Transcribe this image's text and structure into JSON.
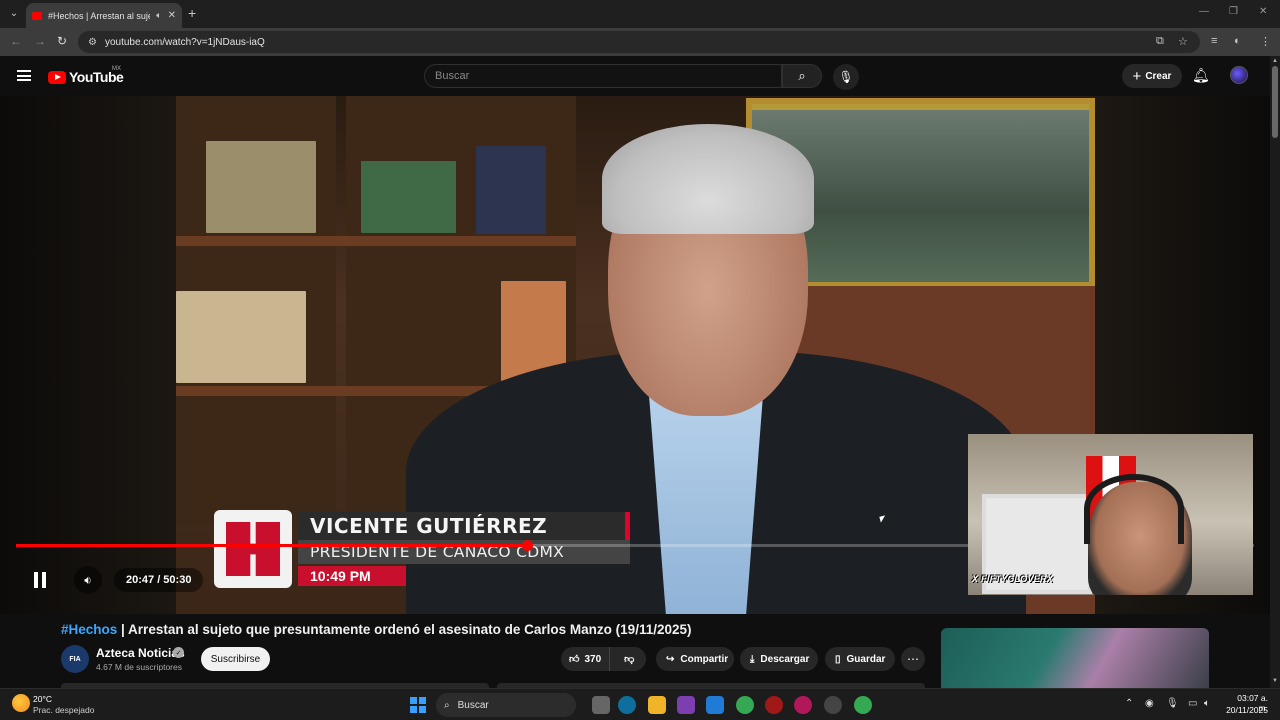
{
  "browser": {
    "tab_title": "#Hechos | Arrestan al sujeto",
    "url": "youtube.com/watch?v=1jNDaus-iaQ"
  },
  "youtube": {
    "logo_text": "YouTube",
    "country_code": "MX",
    "search_placeholder": "Buscar",
    "create_label": "Crear"
  },
  "player": {
    "lower_third_name": "VICENTE GUTIÉRREZ",
    "lower_third_role": "PRESIDENTE DE CANACO CDMX",
    "lower_third_time": "10:49 PM",
    "time_display": "20:47 / 50:30",
    "progress_fraction": 0.4125,
    "webcam_label": "X FIFTYCLOVERX",
    "state": "playing"
  },
  "video": {
    "hashtag": "#Hechos",
    "title_rest": " | Arrestan al sujeto que presuntamente ordenó el asesinato de Carlos Manzo (19/11/2025)",
    "channel_name": "Azteca Noticias",
    "channel_avatar_text": "FIA",
    "subscribers": "4.67 M de suscriptores",
    "subscribe_label": "Suscribirse",
    "likes": "370",
    "share_label": "Compartir",
    "download_label": "Descargar",
    "save_label": "Guardar"
  },
  "taskbar": {
    "temperature": "20°C",
    "weather": "Prac. despejado",
    "search_label": "Buscar",
    "time": "03:07 a. m.",
    "date": "20/11/2025"
  },
  "colors": {
    "youtube_red": "#ff0000",
    "hashtag_blue": "#3ea6ff",
    "lower_third_red": "#c8102e"
  }
}
